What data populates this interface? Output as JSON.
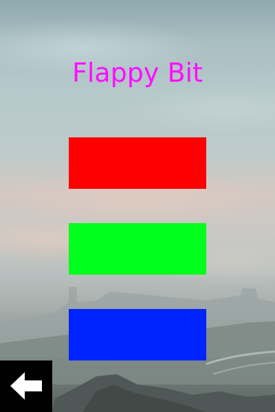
{
  "game": {
    "title": "Flappy Bit"
  },
  "colors": {
    "title": "#ff0dff",
    "red_button": "#ff0000",
    "green_button": "#00ff1c",
    "blue_button": "#0024ff",
    "back_button_bg": "#000000",
    "back_arrow": "#ffffff"
  },
  "buttons": [
    {
      "name": "red",
      "color": "#ff0000"
    },
    {
      "name": "green",
      "color": "#00ff1c"
    },
    {
      "name": "blue",
      "color": "#0024ff"
    }
  ],
  "back_button": {
    "icon": "arrow-left-icon"
  }
}
